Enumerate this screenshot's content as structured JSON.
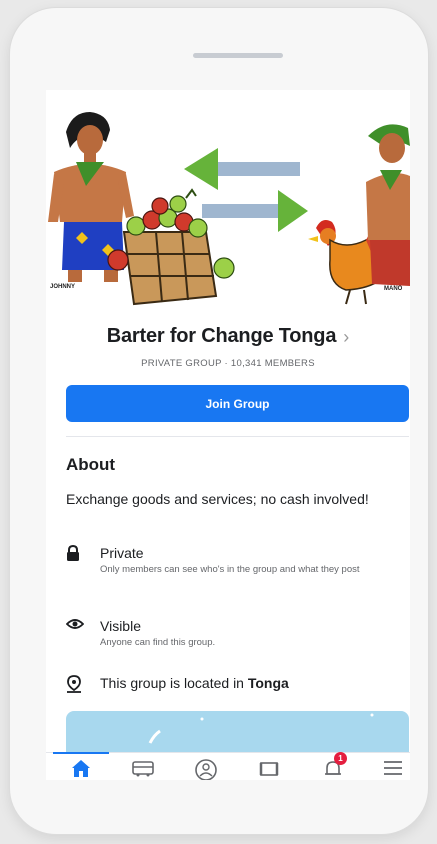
{
  "cover": {
    "left_caption": "JOHNNY",
    "right_caption": "MANO"
  },
  "group": {
    "name": "Barter for Change Tonga",
    "meta": "PRIVATE GROUP · 10,341 MEMBERS",
    "join_label": "Join Group"
  },
  "about": {
    "title": "About",
    "description": "Exchange goods and services; no cash involved!",
    "private_title": "Private",
    "private_sub": "Only members can see who's in the group and what they post",
    "visible_title": "Visible",
    "visible_sub": "Anyone can find this group.",
    "location_prefix": "This group is located in ",
    "location_place": "Tonga"
  },
  "tabs": {
    "active": "home",
    "items": [
      "home-icon",
      "marketplace-icon",
      "groups-icon",
      "watch-icon",
      "notifications-icon",
      "menu-icon"
    ],
    "notification_count": "1"
  },
  "colors": {
    "accent": "#1877f2",
    "badge": "#e41e3f",
    "map": "#a8d8ee"
  }
}
